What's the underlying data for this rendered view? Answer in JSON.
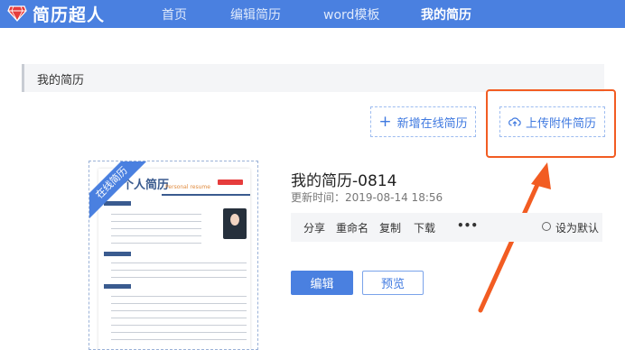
{
  "brand": {
    "name": "简历超人"
  },
  "nav": [
    {
      "label": "首页"
    },
    {
      "label": "编辑简历"
    },
    {
      "label": "word模板"
    },
    {
      "label": "我的简历"
    }
  ],
  "section": {
    "title": "我的简历"
  },
  "buttons": {
    "add_online": "新增在线简历",
    "upload_attachment": "上传附件简历"
  },
  "resume": {
    "ribbon": "在线简历",
    "thumb_title": "个人简历",
    "thumb_subtitle": "Personal resume",
    "title": "我的简历-0814",
    "updated": "更新时间：2019-08-14 18:56",
    "actions": [
      "分享",
      "重命名",
      "复制",
      "下载",
      "•••"
    ],
    "set_default": "设为默认",
    "edit": "编辑",
    "preview": "预览"
  },
  "colors": {
    "brand_blue": "#4a80e0",
    "highlight_orange": "#f25c22"
  }
}
